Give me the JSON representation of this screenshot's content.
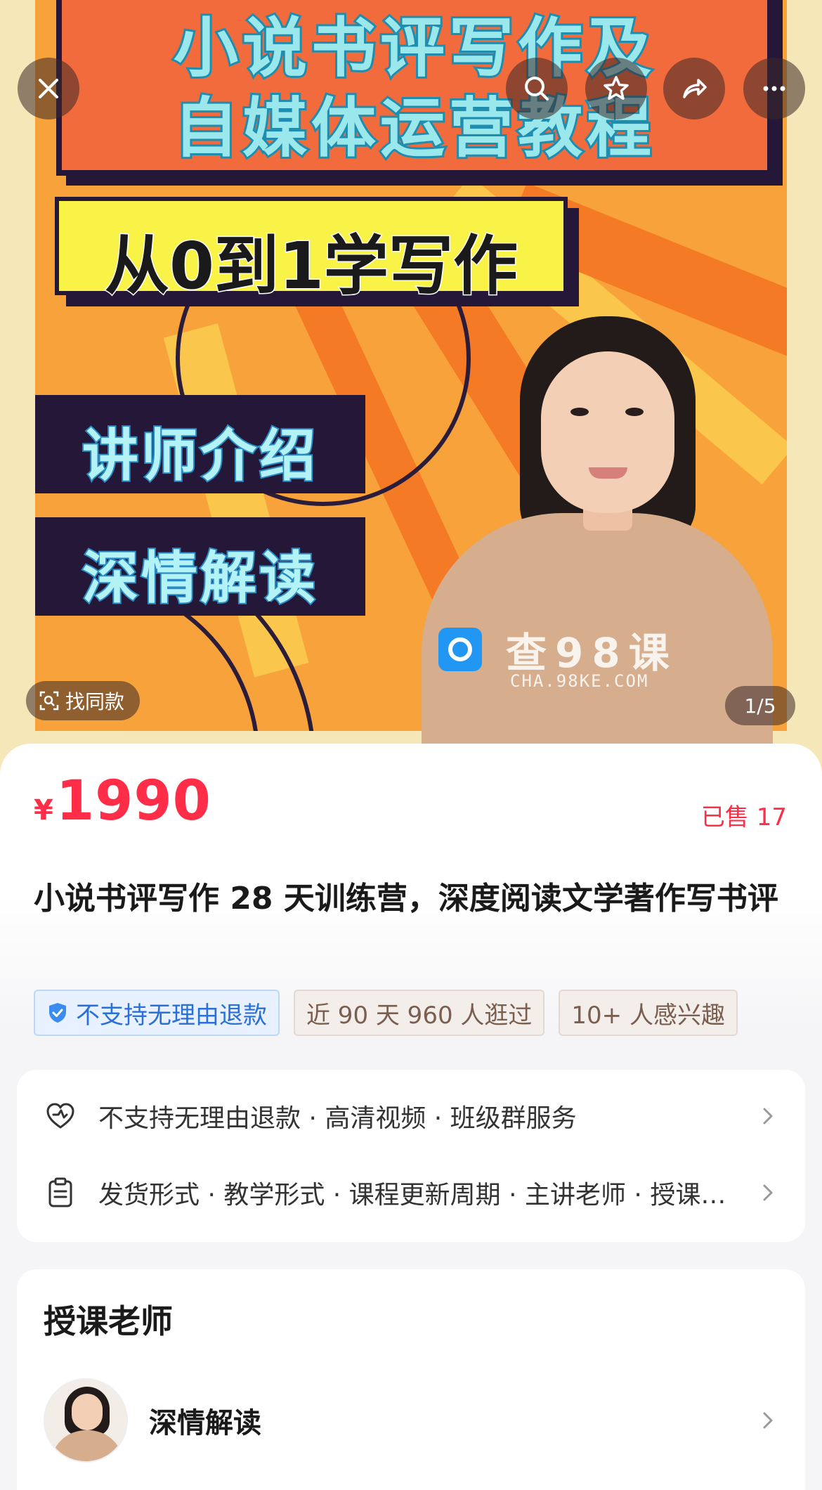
{
  "hero": {
    "title_line1": "小说书评写作及",
    "title_line2": "自媒体运营教程",
    "subtitle": "从0到1学写作",
    "box1": "讲师介绍",
    "box2": "深情解读",
    "watermark_main": "查98课",
    "watermark_sub": "CHA.98KE.COM",
    "find_same_label": "找同款",
    "page_counter": "1/5"
  },
  "product": {
    "currency": "¥",
    "price": "1990",
    "sold": "已售 17",
    "title": "小说书评写作 28 天训练营，深度阅读文学著作写书评",
    "tags": [
      {
        "label": "不支持无理由退款"
      },
      {
        "label": "近 90 天 960 人逛过"
      },
      {
        "label": "10+ 人感兴趣"
      }
    ]
  },
  "service": {
    "row1": "不支持无理由退款 · 高清视频 · 班级群服务",
    "row2": "发货形式 · 教学形式 · 课程更新周期 · 主讲老师 · 授课方式"
  },
  "teacher": {
    "section_title": "授课老师",
    "name": "深情解读"
  },
  "colors": {
    "accent_red": "#ff2d47",
    "tag_blue": "#2b6fd8",
    "poster_orange": "#f7a23a"
  },
  "icons": [
    "close-icon",
    "search-icon",
    "star-icon",
    "share-icon",
    "more-icon",
    "scan-icon",
    "shield-icon",
    "heart-icon",
    "clipboard-icon",
    "chevron-right-icon"
  ]
}
